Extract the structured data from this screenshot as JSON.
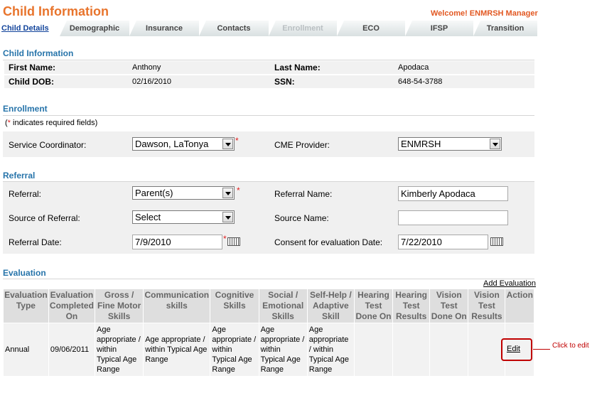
{
  "header": {
    "title": "Child Information",
    "welcome": "Welcome! ENMRSH Manager"
  },
  "tabs": [
    {
      "label": "Child Details",
      "state": "active"
    },
    {
      "label": "Demographic",
      "state": "normal"
    },
    {
      "label": "Insurance",
      "state": "normal"
    },
    {
      "label": "Contacts",
      "state": "normal"
    },
    {
      "label": "Enrollment",
      "state": "disabled"
    },
    {
      "label": "ECO",
      "state": "normal"
    },
    {
      "label": "IFSP",
      "state": "normal"
    },
    {
      "label": "Transition",
      "state": "normal"
    }
  ],
  "child_info": {
    "section_title": "Child Information",
    "first_name_label": "First Name:",
    "first_name": "Anthony",
    "last_name_label": "Last Name:",
    "last_name": "Apodaca",
    "dob_label": "Child DOB:",
    "dob": "02/16/2010",
    "ssn_label": "SSN:",
    "ssn": "648-54-3788"
  },
  "enrollment": {
    "section_title": "Enrollment",
    "required_note_star": "*",
    "required_note": " indicates required fields)",
    "required_note_open": "(",
    "service_coordinator_label": "Service Coordinator:",
    "service_coordinator_value": "Dawson, LaTonya",
    "cme_provider_label": "CME Provider:",
    "cme_provider_value": "ENMRSH"
  },
  "referral": {
    "section_title": "Referral",
    "referral_label": "Referral:",
    "referral_value": "Parent(s)",
    "referral_name_label": "Referral Name:",
    "referral_name_value": "Kimberly Apodaca",
    "source_label": "Source of Referral:",
    "source_value": "Select",
    "source_name_label": "Source Name:",
    "source_name_value": "",
    "referral_date_label": "Referral Date:",
    "referral_date_value": "7/9/2010",
    "consent_label": "Consent for evaluation Date:",
    "consent_value": "7/22/2010",
    "required_star": "*"
  },
  "evaluation": {
    "section_title": "Evaluation",
    "add_link": "Add Evaluation",
    "columns": [
      "Evaluation Type",
      "Evaluation Completed On",
      "Gross / Fine Motor Skills",
      "Communication skills",
      "Cognitive Skills",
      "Social / Emotional Skills",
      "Self-Help / Adaptive Skill",
      "Hearing Test Done On",
      "Hearing Test Results",
      "Vision Test Done On",
      "Vision Test Results",
      "Action"
    ],
    "rows": [
      {
        "type": "Annual",
        "completed_on": "09/06/2011",
        "gross_fine_motor": "Age appropriate / within Typical Age Range",
        "communication": "Age appropriate / within Typical Age Range",
        "cognitive": "Age appropriate / within Typical Age Range",
        "social_emotional": "Age appropriate / within Typical Age Range",
        "self_help": "Age appropriate / within Typical Age Range",
        "hearing_done": "",
        "hearing_results": "",
        "vision_done": "",
        "vision_results": "",
        "action": "Edit"
      }
    ]
  },
  "callout": {
    "text": "Click to edit"
  },
  "colors": {
    "title": "#e8742c",
    "section": "#2774aa",
    "callout": "#c00000",
    "required": "#e02020"
  }
}
